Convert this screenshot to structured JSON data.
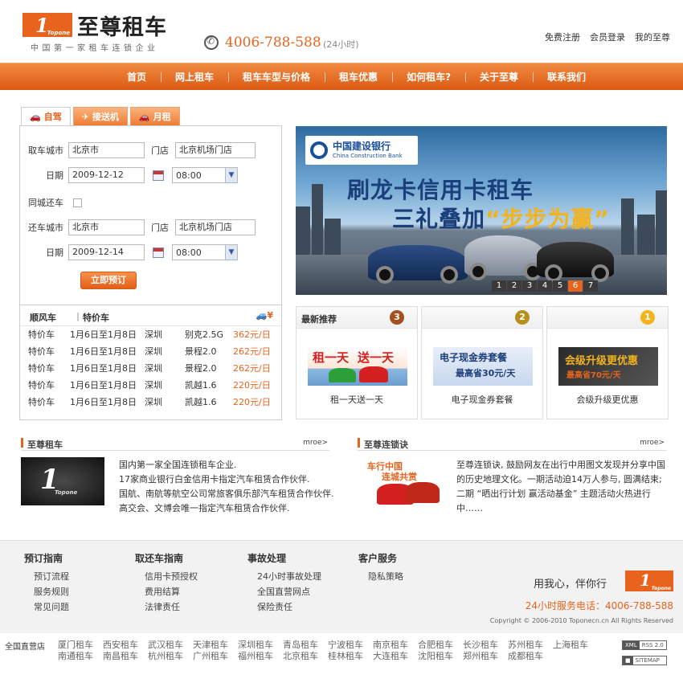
{
  "header": {
    "logo_mark": "1",
    "logo_brand": "Topone",
    "title": "至尊租车",
    "subtitle": "中国第一家租车连锁企业",
    "hotline": "4006-788-588",
    "hotline_note": "(24小时)",
    "top_links": [
      "免费注册",
      "会员登录",
      "我的至尊"
    ]
  },
  "nav": {
    "items": [
      "首页",
      "网上租车",
      "租车车型与价格",
      "租车优惠",
      "如何租车?",
      "关于至尊",
      "联系我们"
    ],
    "active_index": 0
  },
  "booking": {
    "tabs": [
      {
        "label": "自驾",
        "icon": "car-key-icon"
      },
      {
        "label": "接送机",
        "icon": "car-plane-icon"
      },
      {
        "label": "月租",
        "icon": "car-30-icon"
      }
    ],
    "active_tab": 0,
    "pickup_city_label": "取车城市",
    "pickup_city": "北京市",
    "store_label": "门店",
    "pickup_store": "北京机场门店",
    "date_label": "日期",
    "pickup_date": "2009-12-12",
    "pickup_time": "08:00",
    "same_city_label": "同城还车",
    "return_city_label": "还车城市",
    "return_city": "北京市",
    "return_store": "北京机场门店",
    "return_date": "2009-12-14",
    "return_time": "08:00",
    "book_button": "立即预订"
  },
  "special": {
    "tab1": "顺风车",
    "tab2": "特价车",
    "icon_symbol": "¥",
    "rows": [
      {
        "type": "特价车",
        "dates": "1月6日至1月8日",
        "city": "深圳",
        "model": "别克2.5G",
        "price": "362元/日"
      },
      {
        "type": "特价车",
        "dates": "1月6日至1月8日",
        "city": "深圳",
        "model": "景程2.0",
        "price": "262元/日"
      },
      {
        "type": "特价车",
        "dates": "1月6日至1月8日",
        "city": "深圳",
        "model": "景程2.0",
        "price": "262元/日"
      },
      {
        "type": "特价车",
        "dates": "1月6日至1月8日",
        "city": "深圳",
        "model": "凯越1.6",
        "price": "220元/日"
      },
      {
        "type": "特价车",
        "dates": "1月6日至1月8日",
        "city": "深圳",
        "model": "凯越1.6",
        "price": "220元/日"
      }
    ]
  },
  "banner": {
    "bank_cn": "中国建设银行",
    "bank_en": "China Construction Bank",
    "headline1": "刷龙卡信用卡租车",
    "headline2_prefix": "三礼叠加",
    "headline2_highlight": "“步步为赢”",
    "pages": [
      "1",
      "2",
      "3",
      "4",
      "5",
      "6",
      "7"
    ],
    "active_page_index": 5
  },
  "promos": {
    "section_title": "最新推荐",
    "cards": [
      {
        "rank": "3",
        "rank_color": "#a0511e",
        "image_text1": "租一天",
        "image_text2": "送一天",
        "caption": "租一天送一天"
      },
      {
        "rank": "2",
        "rank_color": "#b8901e",
        "image_text1": "电子现金券套餐",
        "image_text2": "最高省30元/天",
        "caption": "电子现金券套餐"
      },
      {
        "rank": "1",
        "rank_color": "#f2b31d",
        "image_text1": "会级升级更优惠",
        "image_text2": "最高省70元/天",
        "caption": "会级升级更优惠"
      }
    ]
  },
  "about": {
    "title": "至尊租车",
    "more": "mroe>",
    "lines": [
      "国内第一家全国连锁租车企业.",
      "17家商业银行白金信用卡指定汽车租赁合作伙伴.",
      "国航、南航等航空公司常旅客俱乐部汽车租赁合作伙伴.",
      "高交会、文博会唯一指定汽车租赁合作伙伴."
    ]
  },
  "chain": {
    "title": "至尊连锁诀",
    "more": "mroe>",
    "image_text1": "车行中国",
    "image_text2": "连城共赏",
    "lines": [
      "至尊连锁诀, 鼓励网友在出行中用图文发现并分享中国",
      "的历史地理文化。一期活动迫14万人参与, 圆满结束;",
      "二期 “晒出行计划 赢活动基金” 主题活动火热进行",
      "中……"
    ]
  },
  "footer": {
    "columns": [
      {
        "title": "预订指南",
        "items": [
          "预订流程",
          "服务规则",
          "常见问题"
        ]
      },
      {
        "title": "取还车指南",
        "items": [
          "信用卡预授权",
          "费用结算",
          "法律责任"
        ]
      },
      {
        "title": "事故处理",
        "items": [
          "24小时事故处理",
          "全国直营网点",
          "保险责任"
        ]
      },
      {
        "title": "客户服务",
        "items": [
          "隐私策略"
        ]
      }
    ],
    "slogan": "用我心，伴你行",
    "service": "24小时服务电话：4006-788-588",
    "copyright": "Copyright © 2006-2010 Toponecn.cn All Rights Reserved"
  },
  "stores": {
    "label": "全国直营店",
    "cities": [
      "厦门租车",
      "西安租车",
      "武汉租车",
      "天津租车",
      "深圳租车",
      "青岛租车",
      "宁波租车",
      "南京租车",
      "合肥租车",
      "长沙租车",
      "苏州租车",
      "上海租车",
      "南通租车",
      "南昌租车",
      "杭州租车",
      "广州租车",
      "福州租车",
      "北京租车",
      "桂林租车",
      "大连租车",
      "沈阳租车",
      "郑州租车",
      "成都租车"
    ],
    "badge_xml_a": "XML",
    "badge_xml_b": "RSS 2.0",
    "badge_sitemap_b": "SITEMAP"
  },
  "colors": {
    "brand_orange": "#e8641e",
    "bank_blue": "#1a4f9c",
    "headline_blue": "#1a3f7a",
    "highlight_gold": "#f2b31d"
  }
}
